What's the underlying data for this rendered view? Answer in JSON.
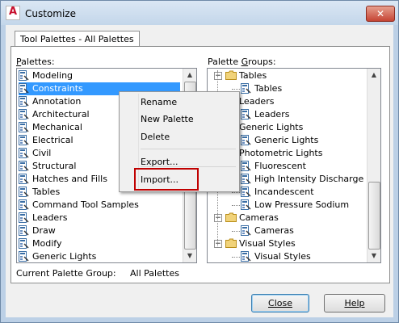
{
  "window": {
    "title": "Customize",
    "close_glyph": "✕",
    "logo_letter": "A",
    "logo_icon": "autocad-logo-icon"
  },
  "tab": {
    "label": "Tool Palettes - All Palettes"
  },
  "palettes": {
    "label": "Palettes:",
    "items": [
      "Modeling",
      "Constraints",
      "Annotation",
      "Architectural",
      "Mechanical",
      "Electrical",
      "Civil",
      "Structural",
      "Hatches and Fills",
      "Tables",
      "Command Tool Samples",
      "Leaders",
      "Draw",
      "Modify",
      "Generic Lights"
    ],
    "selected": "Constraints"
  },
  "palette_groups": {
    "label": "Palette Groups:",
    "tree": [
      {
        "level": 0,
        "text": "Tables",
        "expander": "−"
      },
      {
        "level": 1,
        "text": "Tables"
      },
      {
        "level": 0,
        "text": "Leaders",
        "expander": "−"
      },
      {
        "level": 1,
        "text": "Leaders"
      },
      {
        "level": 0,
        "text": "Generic Lights",
        "expander": "−"
      },
      {
        "level": 1,
        "text": "Generic Lights"
      },
      {
        "level": 0,
        "text": "Photometric Lights",
        "expander": "−"
      },
      {
        "level": 1,
        "text": "Fluorescent"
      },
      {
        "level": 1,
        "text": "High Intensity Discharge"
      },
      {
        "level": 1,
        "text": "Incandescent"
      },
      {
        "level": 1,
        "text": "Low Pressure Sodium"
      },
      {
        "level": 0,
        "text": "Cameras",
        "expander": "−"
      },
      {
        "level": 1,
        "text": "Cameras"
      },
      {
        "level": 0,
        "text": "Visual Styles",
        "expander": "−"
      },
      {
        "level": 1,
        "text": "Visual Styles"
      }
    ]
  },
  "context_menu": {
    "items": [
      "Rename",
      "New Palette",
      "Delete",
      "Export...",
      "Import..."
    ]
  },
  "current_group": {
    "label": "Current Palette Group:",
    "value": "All Palettes"
  },
  "buttons": {
    "close": "Close",
    "help": "Help"
  },
  "colors": {
    "accent": "#3399ff",
    "highlight": "#c00000"
  }
}
